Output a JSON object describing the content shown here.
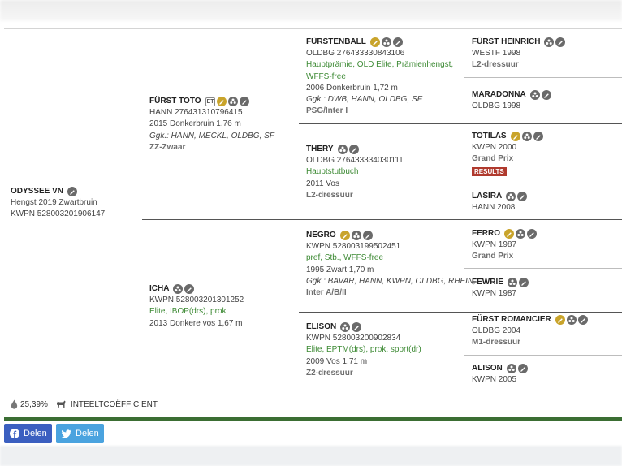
{
  "horse": {
    "name": "ODYSSEE VN",
    "line1": "Hengst 2019 Zwartbruin",
    "line2": "KWPN 528003201906147"
  },
  "sire": {
    "name": "FÜRST TOTO",
    "badge": "ET",
    "reg": "HANN 276431310796415",
    "info": "2015 Donkerbruin 1,76 m",
    "gk": "Ggk.: HANN, MECKL, OLDBG, SF",
    "sport": "ZZ-Zwaar"
  },
  "dam": {
    "name": "ICHA",
    "reg": "KWPN 528003201301252",
    "pred": "Elite, IBOP(drs), prok",
    "info": "2013 Donkere vos 1,67 m"
  },
  "gen3": [
    {
      "name": "FÜRSTENBALL",
      "reg": "OLDBG 276433330843106",
      "pred1": "Hauptprämie, OLD Elite, Prämienhengst,",
      "pred2": "WFFS-free",
      "info": "2006 Donkerbruin 1,72 m",
      "gk": "Ggk.: DWB, HANN, OLDBG, SF",
      "sport": "PSG/Inter I"
    },
    {
      "name": "THERY",
      "reg": "OLDBG 276433334030111",
      "pred1": "Hauptstutbuch",
      "info": "2011 Vos",
      "sport": "L2-dressuur"
    },
    {
      "name": "NEGRO",
      "reg": "KWPN 528003199502451",
      "pred1": "pref, Stb., WFFS-free",
      "info": "1995 Zwart 1,70 m",
      "gk": "Ggk.: BAVAR, HANN, KWPN, OLDBG, RHEIN,...",
      "sport": "Inter A/B/II"
    },
    {
      "name": "ELISON",
      "reg": "KWPN 528003200902834",
      "pred1": "Elite, EPTM(drs), prok, sport(dr)",
      "info": "2009 Vos 1,71 m",
      "sport": "Z2-dressuur"
    }
  ],
  "gen4": [
    {
      "name": "FÜRST HEINRICH",
      "reg": "WESTF 1998",
      "sport": "L2-dressuur"
    },
    {
      "name": "MARADONNA",
      "reg": "OLDBG 1998"
    },
    {
      "name": "TOTILAS",
      "reg": "KWPN 2000",
      "sport": "Grand Prix",
      "results": "RESULTS"
    },
    {
      "name": "LASIRA",
      "reg": "HANN 2008"
    },
    {
      "name": "FERRO",
      "reg": "KWPN 1987",
      "sport": "Grand Prix"
    },
    {
      "name": "FEWRIE",
      "reg": "KWPN 1987"
    },
    {
      "name": "FÜRST ROMANCIER",
      "reg": "OLDBG 2004",
      "sport": "M1-dressuur"
    },
    {
      "name": "ALISON",
      "reg": "KWPN 2005"
    }
  ],
  "stats": {
    "percent": "25,39%",
    "label": "INTEELTCOËFFICIENT"
  },
  "share": {
    "facebook": "Delen",
    "twitter": "Delen"
  },
  "colors": {
    "green": "#3d8a34",
    "footer_bar": "#3b6e33",
    "facebook": "#3b5fc0",
    "twitter": "#4aa3df",
    "results": "#b03a2e"
  },
  "icons": [
    "pencil-icon",
    "offspring-icon",
    "gold-medal-icon"
  ]
}
